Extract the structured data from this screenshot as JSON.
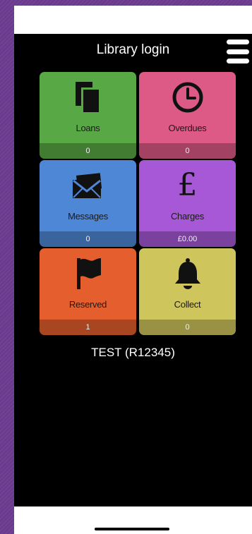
{
  "header": {
    "title": "Library login",
    "menu_icon": "hamburger-menu-icon"
  },
  "tiles": [
    {
      "id": "loans",
      "label": "Loans",
      "count": "0",
      "icon": "documents-icon",
      "color": "#59a846"
    },
    {
      "id": "overdues",
      "label": "Overdues",
      "count": "0",
      "icon": "clock-icon",
      "color": "#dc5a85"
    },
    {
      "id": "messages",
      "label": "Messages",
      "count": "0",
      "icon": "envelope-icon",
      "color": "#4e87d6"
    },
    {
      "id": "charges",
      "label": "Charges",
      "count": "£0.00",
      "icon": "pound-icon",
      "glyph": "£",
      "color": "#a758d6"
    },
    {
      "id": "reserved",
      "label": "Reserved",
      "count": "1",
      "icon": "flag-icon",
      "color": "#e55f2e"
    },
    {
      "id": "collect",
      "label": "Collect",
      "count": "0",
      "icon": "bell-icon",
      "color": "#cfc55d"
    }
  ],
  "user": {
    "display": "TEST (R12345)"
  },
  "colors": {
    "background": "#000000",
    "text": "#ffffff"
  }
}
